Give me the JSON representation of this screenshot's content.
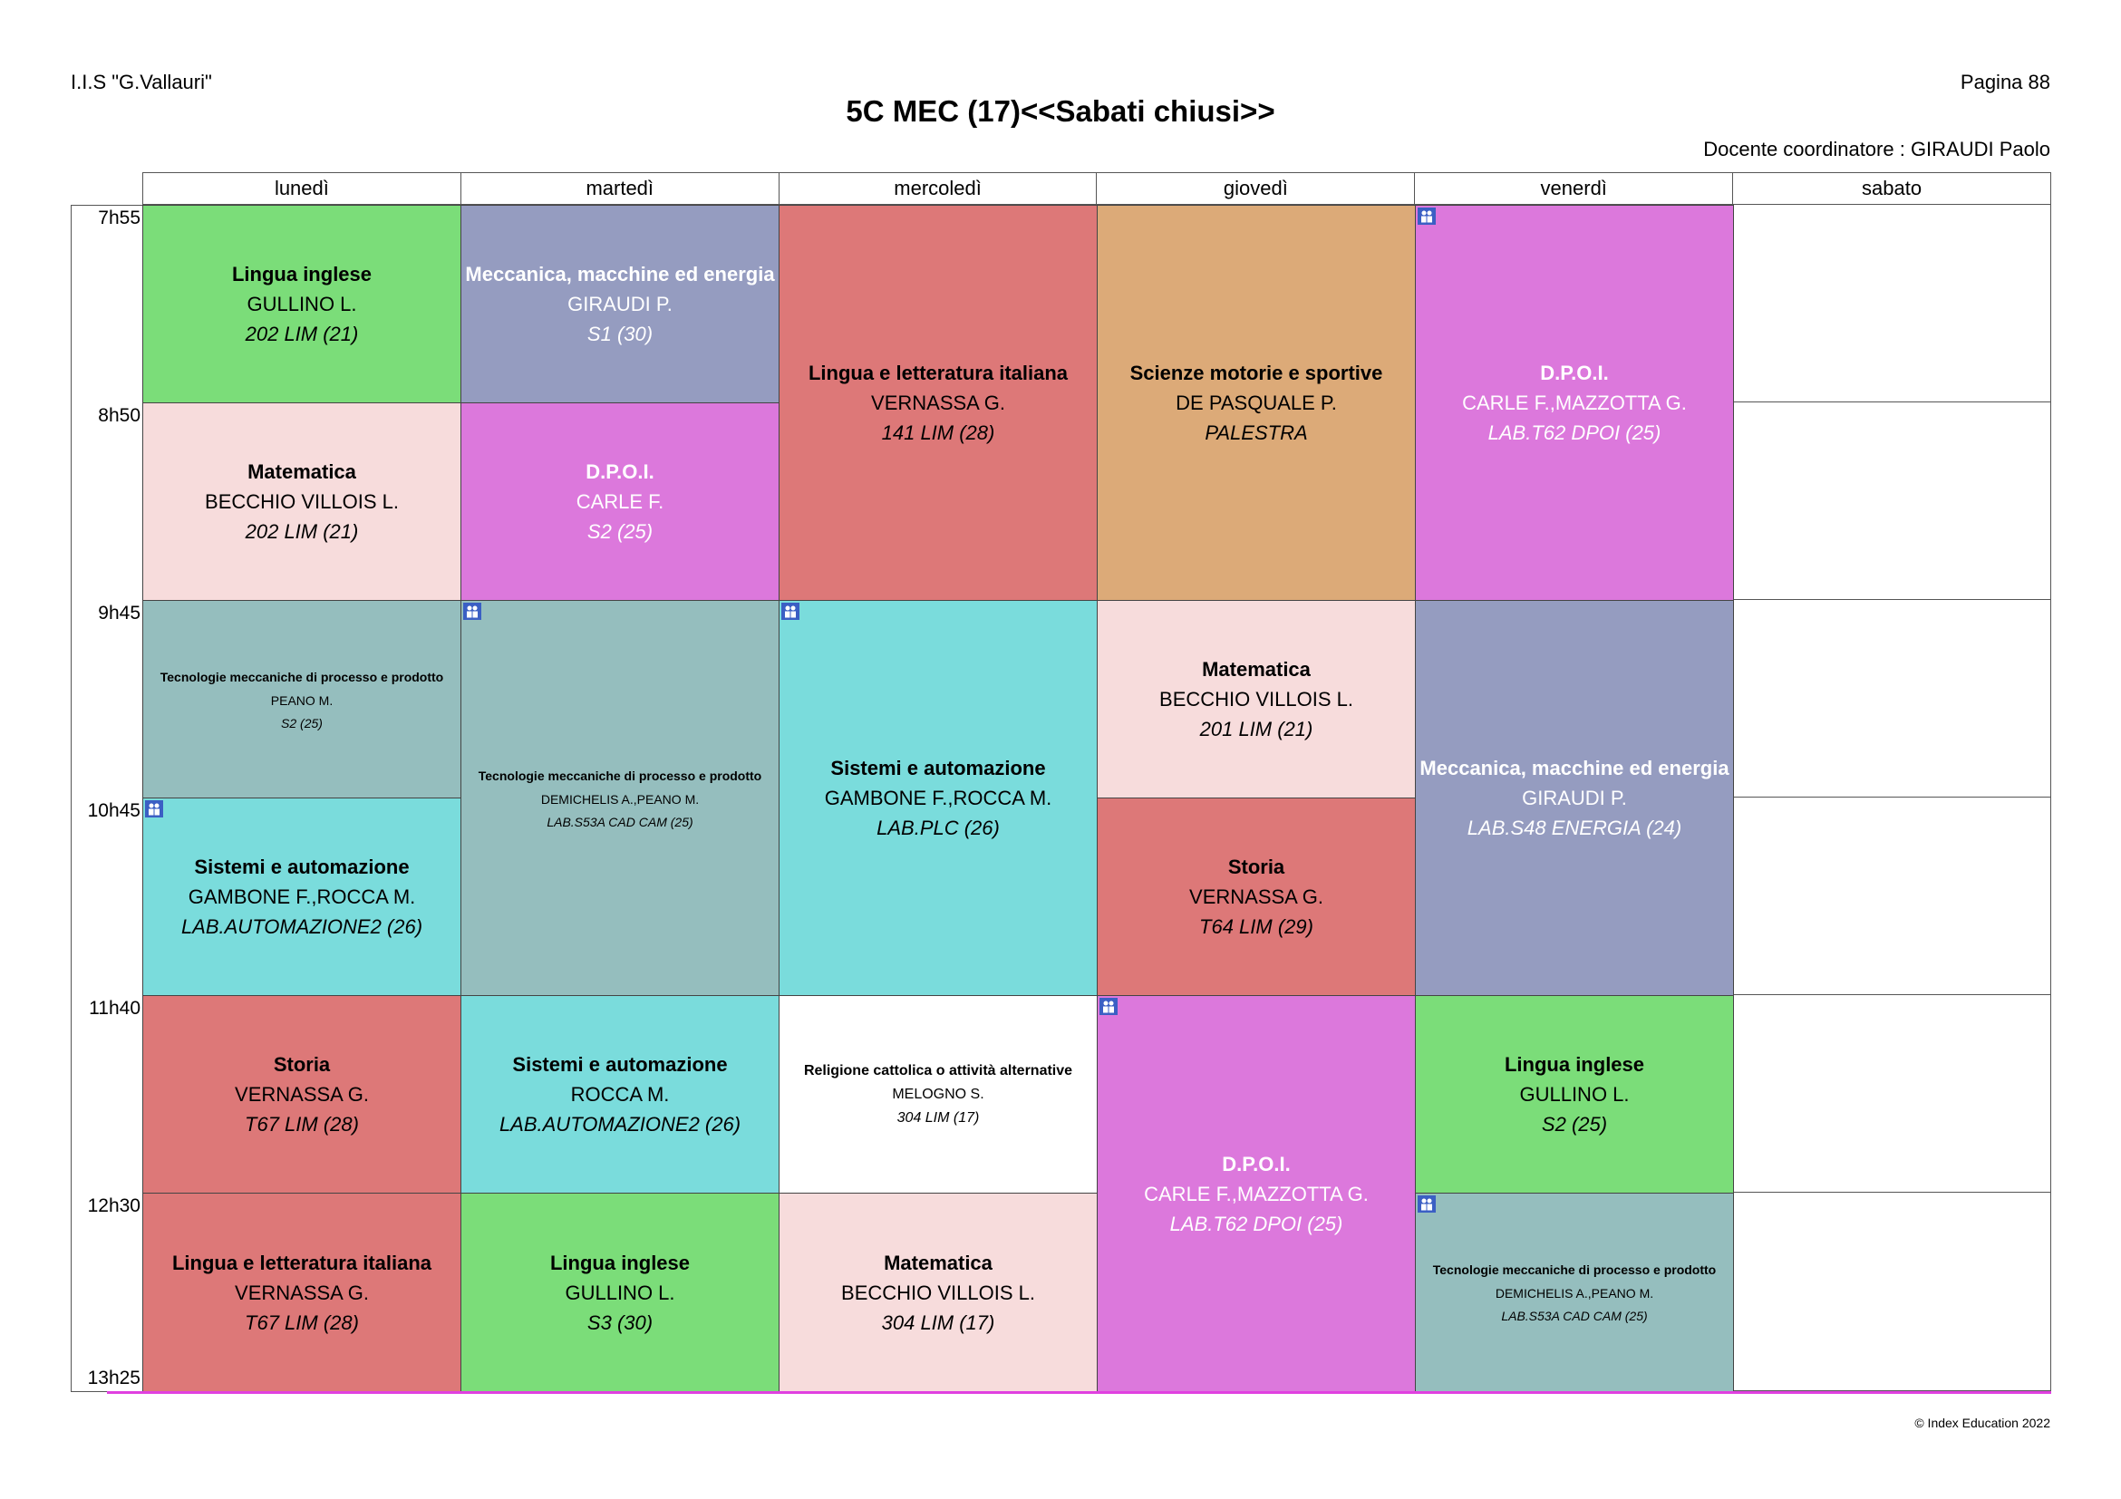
{
  "header": {
    "school": "I.I.S \"G.Vallauri\"",
    "page": "Pagina 88",
    "title": "5C MEC (17)<<Sabati chiusi>>",
    "coordinator": "Docente coordinatore : GIRAUDI Paolo"
  },
  "days": [
    "lunedì",
    "martedì",
    "mercoledì",
    "giovedì",
    "venerdì",
    "sabato"
  ],
  "times": [
    "7h55",
    "8h50",
    "9h45",
    "10h45",
    "11h40",
    "12h30",
    "13h25"
  ],
  "colors": {
    "green": "#7bdd79",
    "lavender": "#959cc0",
    "red": "#dd7878",
    "orange": "#dcaa78",
    "magenta": "#dc78dc",
    "pink": "#f7dcdc",
    "teal": "#95bebe",
    "cyan": "#7adcdc",
    "white": "#ffffff",
    "group_icon": "#3b5fc4",
    "end_line": "#e040e0"
  },
  "lessons": [
    {
      "subject": "Lingua inglese",
      "teacher": "GULLINO L.",
      "room": "202 LIM (21)"
    },
    {
      "subject": "Matematica",
      "teacher": "BECCHIO VILLOIS L.",
      "room": "202 LIM (21)"
    },
    {
      "subject": "Tecnologie meccaniche di processo e prodotto",
      "teacher": "PEANO M.",
      "room": "S2 (25)"
    },
    {
      "subject": "Sistemi e automazione",
      "teacher": "GAMBONE F.,ROCCA M.",
      "room": "LAB.AUTOMAZIONE2 (26)"
    },
    {
      "subject": "Storia",
      "teacher": "VERNASSA G.",
      "room": "T67 LIM (28)"
    },
    {
      "subject": "Lingua e letteratura italiana",
      "teacher": "VERNASSA G.",
      "room": "T67 LIM (28)"
    },
    {
      "subject": "Meccanica, macchine ed energia",
      "teacher": "GIRAUDI P.",
      "room": "S1 (30)"
    },
    {
      "subject": "D.P.O.I.",
      "teacher": "CARLE F.",
      "room": "S2 (25)"
    },
    {
      "subject": "Tecnologie meccaniche di processo e prodotto",
      "teacher": "DEMICHELIS A.,PEANO M.",
      "room": "LAB.S53A CAD CAM (25)"
    },
    {
      "subject": "Sistemi e automazione",
      "teacher": "ROCCA M.",
      "room": "LAB.AUTOMAZIONE2 (26)"
    },
    {
      "subject": "Lingua inglese",
      "teacher": "GULLINO L.",
      "room": "S3 (30)"
    },
    {
      "subject": "Lingua e letteratura italiana",
      "teacher": "VERNASSA G.",
      "room": "141 LIM (28)"
    },
    {
      "subject": "Sistemi e automazione",
      "teacher": "GAMBONE F.,ROCCA M.",
      "room": "LAB.PLC (26)"
    },
    {
      "subject": "Religione cattolica o attività alternative",
      "teacher": "MELOGNO S.",
      "room": "304 LIM (17)"
    },
    {
      "subject": "Matematica",
      "teacher": "BECCHIO VILLOIS L.",
      "room": "304 LIM (17)"
    },
    {
      "subject": "Scienze motorie e sportive",
      "teacher": "DE PASQUALE P.",
      "room": "PALESTRA"
    },
    {
      "subject": "Matematica",
      "teacher": "BECCHIO VILLOIS L.",
      "room": "201 LIM (21)"
    },
    {
      "subject": "Storia",
      "teacher": "VERNASSA G.",
      "room": "T64 LIM (29)"
    },
    {
      "subject": "D.P.O.I.",
      "teacher": "CARLE F.,MAZZOTTA G.",
      "room": "LAB.T62 DPOI (25)"
    },
    {
      "subject": "D.P.O.I.",
      "teacher": "CARLE F.,MAZZOTTA G.",
      "room": "LAB.T62 DPOI (25)"
    },
    {
      "subject": "Meccanica, macchine ed energia",
      "teacher": "GIRAUDI P.",
      "room": "LAB.S48 ENERGIA (24)"
    },
    {
      "subject": "Lingua inglese",
      "teacher": "GULLINO L.",
      "room": "S2 (25)"
    },
    {
      "subject": "Tecnologie meccaniche di processo e prodotto",
      "teacher": "DEMICHELIS A.,PEANO M.",
      "room": "LAB.S53A CAD CAM (25)"
    }
  ],
  "footer": "© Index Education 2022"
}
